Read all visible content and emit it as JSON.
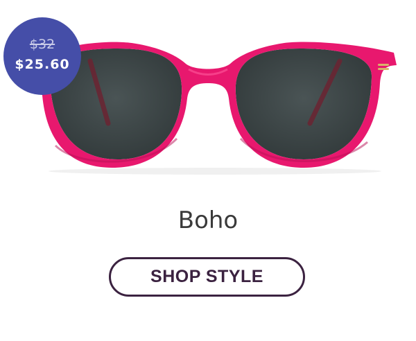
{
  "product": {
    "name": "Boho",
    "image_icon": "sunglasses-icon",
    "frame_color": "#e8186e",
    "lens_color": "#3f4849"
  },
  "price_badge": {
    "original_price": "$32",
    "sale_price": "$25.60",
    "badge_color": "#454ea8"
  },
  "cta": {
    "label": "SHOP STYLE",
    "border_color": "#3b2240"
  }
}
